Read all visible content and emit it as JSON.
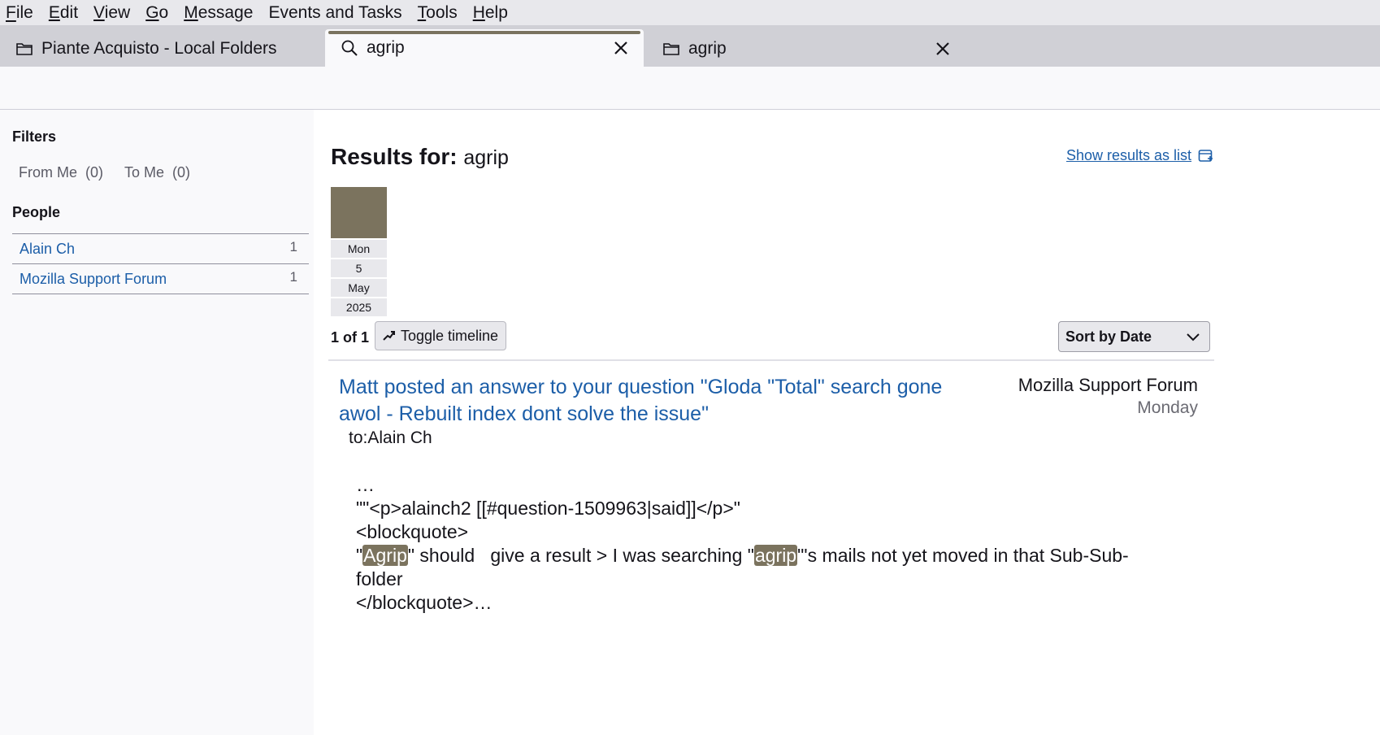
{
  "menu": [
    "File",
    "Edit",
    "View",
    "Go",
    "Message",
    "Events and Tasks",
    "Tools",
    "Help"
  ],
  "menu_accel": [
    "F",
    "E",
    "V",
    "G",
    "M",
    "",
    "T",
    "H"
  ],
  "tabs": [
    {
      "label": "Piante Acquisto - Local Folders",
      "icon": "folder-icon",
      "closable": false
    },
    {
      "label": "agrip",
      "icon": "search-icon",
      "closable": true,
      "active": true
    },
    {
      "label": "agrip",
      "icon": "folder-icon",
      "closable": true
    }
  ],
  "sidebar": {
    "filters_heading": "Filters",
    "from_me": "From Me",
    "from_me_count": "(0)",
    "to_me": "To Me",
    "to_me_count": "(0)",
    "people_heading": "People",
    "people": [
      {
        "name": "Alain Ch",
        "count": "1"
      },
      {
        "name": "Mozilla Support Forum",
        "count": "1"
      }
    ]
  },
  "results": {
    "label": "Results for:",
    "query": "agrip",
    "show_list": "Show results as list",
    "timeline": {
      "day": "Mon",
      "date": "5",
      "month": "May",
      "year": "2025"
    },
    "pager": "1 of 1",
    "toggle_timeline": "Toggle timeline",
    "sort": "Sort by Date"
  },
  "message": {
    "subject": "Matt posted an answer to your question \"Gloda \"Total\" search gone awol - Rebuilt index dont solve the issue\"",
    "to": "to:Alain Ch",
    "from": "Mozilla Support Forum",
    "date": "Monday",
    "snippet": {
      "l1": "…",
      "l2": "\"\"<p>alainch2 [[#question-1509963|said]]</p>\"",
      "l3": "<blockquote>",
      "l4a": "\"",
      "l4b": "Agrip",
      "l4c": "\" should   give a result > I was searching \"",
      "l4d": "agrip",
      "l4e": "\"'s mails not yet moved in that Sub-Sub-",
      "l5": "folder",
      "l6": "</blockquote>…"
    }
  },
  "colors": {
    "highlight": "#7b735e",
    "link": "#1c5ea8"
  }
}
